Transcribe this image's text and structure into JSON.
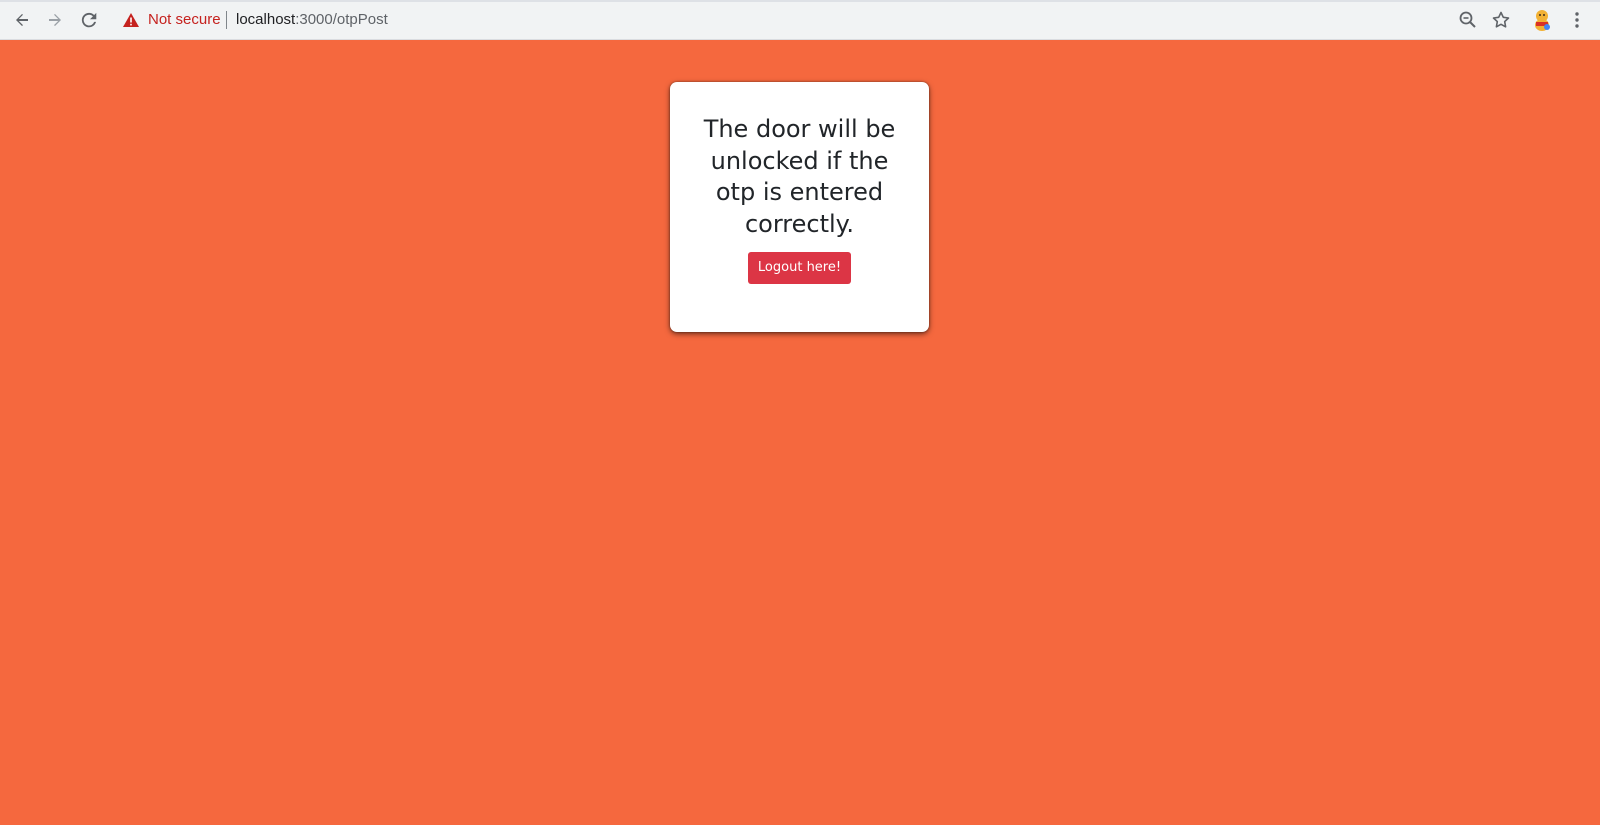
{
  "browser": {
    "security_label": "Not secure",
    "url_host": "localhost",
    "url_path": ":3000/otpPost",
    "icons": {
      "back": "back-arrow-icon",
      "forward": "forward-arrow-icon",
      "reload": "reload-icon",
      "warning": "warning-triangle-icon",
      "zoom": "zoom-out-icon",
      "bookmark": "star-icon",
      "extension": "extension-avatar-icon",
      "menu": "kebab-menu-icon"
    }
  },
  "page": {
    "background_color": "#f5683e",
    "message": "The door will be unlocked if the otp is entered correctly.",
    "logout_button_label": "Logout here!",
    "button_color": "#dc3545"
  }
}
